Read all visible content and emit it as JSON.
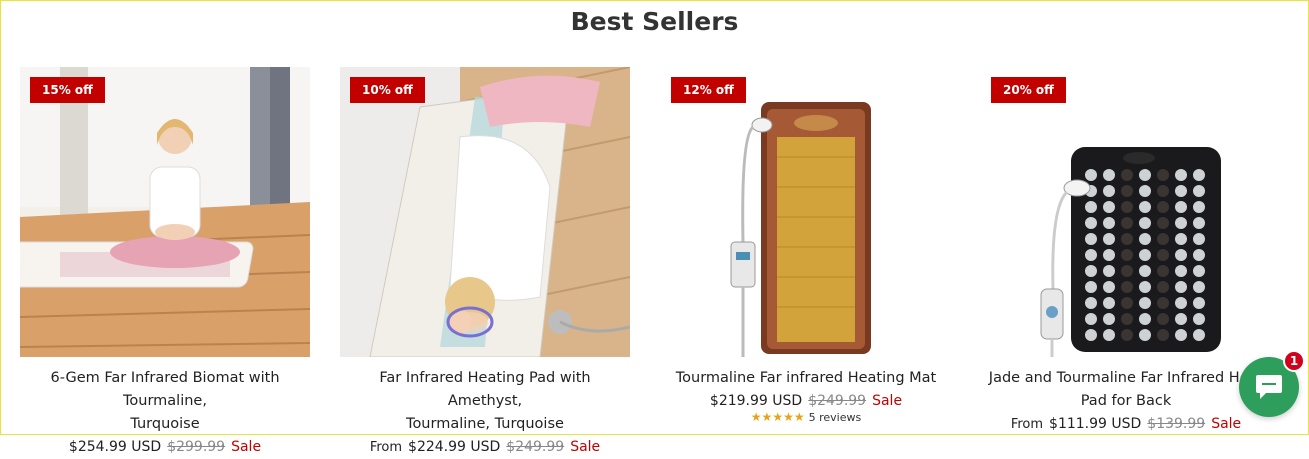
{
  "section": {
    "title": "Best Sellers"
  },
  "products": [
    {
      "badge": "15% off",
      "title_line1": "6-Gem Far Infrared Biomat with Tourmaline,",
      "title_line2": "Turquoise",
      "from": "",
      "price": "$254.99 USD",
      "compare": "$299.99",
      "sale": "Sale",
      "image_icon": "woman-meditating-on-biomat"
    },
    {
      "badge": "10% off",
      "title_line1": "Far Infrared Heating Pad with Amethyst,",
      "title_line2": "Tourmaline, Turquoise",
      "from": "From",
      "price": "$224.99 USD",
      "compare": "$249.99",
      "sale": "Sale",
      "image_icon": "woman-lying-on-heating-pad"
    },
    {
      "badge": "12% off",
      "title_line1": "Tourmaline Far infrared Heating Mat",
      "title_line2": "",
      "from": "",
      "price": "$219.99 USD",
      "compare": "$249.99",
      "sale": "Sale",
      "stars": "★★★★★",
      "reviews": "5 reviews",
      "rating": 5,
      "image_icon": "tourmaline-heating-mat"
    },
    {
      "badge": "20% off",
      "title_line1": "Jade and Tourmaline Far Infrared Heat",
      "title_line2": "Pad for Back",
      "from": "From",
      "price": "$111.99 USD",
      "compare": "$139.99",
      "sale": "Sale",
      "image_icon": "jade-heating-pad"
    }
  ],
  "chat": {
    "unread": "1",
    "icon": "chat-bubble-icon"
  },
  "colors": {
    "sale": "#c20000",
    "badge": "#c20000",
    "chat": "#2e9e5d"
  }
}
